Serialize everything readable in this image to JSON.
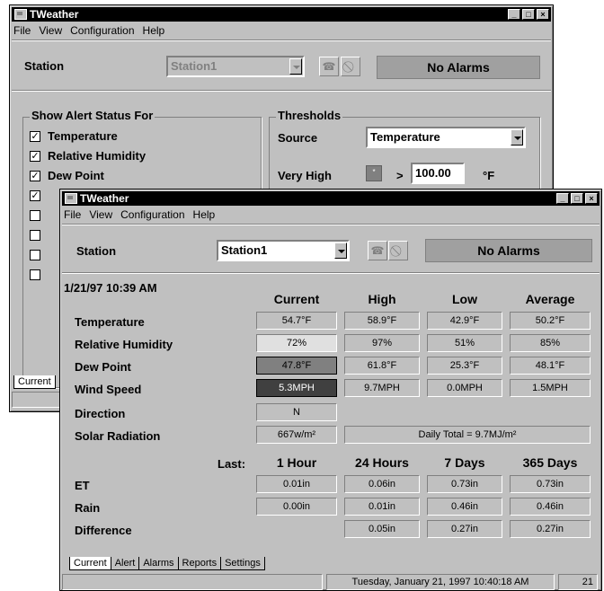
{
  "app_title": "TWeather",
  "menu": {
    "file": "File",
    "view": "View",
    "configuration": "Configuration",
    "help": "Help"
  },
  "back_window": {
    "station_label": "Station",
    "station_value": "Station1",
    "alarm_status": "No Alarms",
    "alert_group_title": "Show Alert Status For",
    "alert_items": [
      {
        "label": "Temperature",
        "checked": true
      },
      {
        "label": "Relative Humidity",
        "checked": true
      },
      {
        "label": "Dew Point",
        "checked": true
      },
      {
        "label": "",
        "checked": true
      },
      {
        "label": "",
        "checked": false
      },
      {
        "label": "",
        "checked": false
      },
      {
        "label": "",
        "checked": false
      },
      {
        "label": "",
        "checked": false
      }
    ],
    "thresholds_title": "Thresholds",
    "source_label": "Source",
    "source_value": "Temperature",
    "very_high_label": "Very High",
    "gt_symbol": ">",
    "very_high_value": "100.00",
    "unit": "°F",
    "tab_current": "Current"
  },
  "front_window": {
    "station_label": "Station",
    "station_value": "Station1",
    "alarm_status": "No Alarms",
    "timestamp": "1/21/97 10:39 AM",
    "columns": [
      "Current",
      "High",
      "Low",
      "Average"
    ],
    "rows": [
      {
        "label": "Temperature",
        "current": "54.7°F",
        "high": "58.9°F",
        "low": "42.9°F",
        "average": "50.2°F"
      },
      {
        "label": "Relative Humidity",
        "current": "72%",
        "high": "97%",
        "low": "51%",
        "average": "85%"
      },
      {
        "label": "Dew Point",
        "current": "47.8°F",
        "high": "61.8°F",
        "low": "25.3°F",
        "average": "48.1°F"
      },
      {
        "label": "Wind Speed",
        "current": "5.3MPH",
        "high": "9.7MPH",
        "low": "0.0MPH",
        "average": "1.5MPH"
      }
    ],
    "direction_label": "Direction",
    "direction_value": "N",
    "solar_label": "Solar Radiation",
    "solar_value": "667w/m²",
    "daily_total": "Daily Total = 9.7MJ/m²",
    "last_label": "Last:",
    "period_columns": [
      "1 Hour",
      "24 Hours",
      "7 Days",
      "365 Days"
    ],
    "period_rows": [
      {
        "label": "ET",
        "values": [
          "0.01in",
          "0.06in",
          "0.73in",
          "0.73in"
        ]
      },
      {
        "label": "Rain",
        "values": [
          "0.00in",
          "0.01in",
          "0.46in",
          "0.46in"
        ]
      },
      {
        "label": "Difference",
        "values": [
          "",
          "0.05in",
          "0.27in",
          "0.27in"
        ]
      }
    ],
    "tabs": [
      "Current",
      "Alert",
      "Alarms",
      "Reports",
      "Settings"
    ],
    "status_datetime": "Tuesday, January 21, 1997  10:40:18 AM",
    "status_number": "21"
  },
  "colors": {
    "window_bg": "#c0c0c0",
    "titlebar": "#000000",
    "alarm_box": "#a0a0a0",
    "humidity_cell": "#e0e0e0",
    "dewpoint_cell": "#808080",
    "wind_cell": "#404040"
  },
  "icons": [
    "app-icon",
    "minimize-icon",
    "maximize-icon",
    "close-icon",
    "phone-icon",
    "no-entry-icon",
    "dropdown-arrow-icon",
    "checkbox-icon"
  ]
}
